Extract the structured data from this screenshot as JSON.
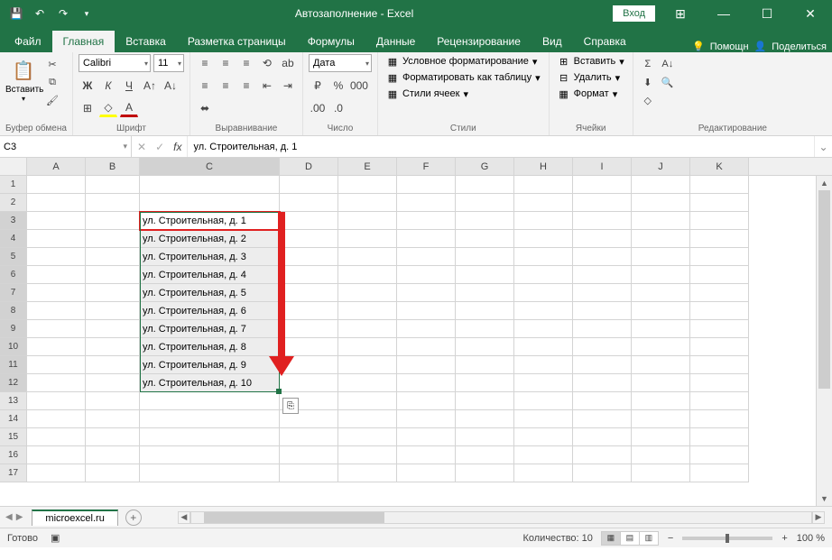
{
  "title": "Автозаполнение  -  Excel",
  "login": "Вход",
  "tabs": {
    "file": "Файл",
    "home": "Главная",
    "insert": "Вставка",
    "layout": "Разметка страницы",
    "formulas": "Формулы",
    "data": "Данные",
    "review": "Рецензирование",
    "view": "Вид",
    "help": "Справка",
    "tell": "Помощн",
    "share": "Поделиться"
  },
  "ribbon": {
    "clipboard": {
      "paste": "Вставить",
      "label": "Буфер обмена"
    },
    "font": {
      "name": "Calibri",
      "size": "11",
      "label": "Шрифт"
    },
    "alignment": {
      "label": "Выравнивание"
    },
    "number": {
      "format": "Дата",
      "label": "Число"
    },
    "styles": {
      "cond": "Условное форматирование",
      "table": "Форматировать как таблицу",
      "cell": "Стили ячеек",
      "label": "Стили"
    },
    "cells": {
      "insert": "Вставить",
      "delete": "Удалить",
      "format": "Формат",
      "label": "Ячейки"
    },
    "editing": {
      "label": "Редактирование"
    }
  },
  "namebox": "C3",
  "formula": "ул. Строительная, д. 1",
  "columns": [
    "A",
    "B",
    "C",
    "D",
    "E",
    "F",
    "G",
    "H",
    "I",
    "J",
    "K"
  ],
  "rows": [
    1,
    2,
    3,
    4,
    5,
    6,
    7,
    8,
    9,
    10,
    11,
    12,
    13,
    14,
    15,
    16,
    17
  ],
  "cells": {
    "C3": "ул. Строительная, д. 1",
    "C4": "ул. Строительная, д. 2",
    "C5": "ул. Строительная, д. 3",
    "C6": "ул. Строительная, д. 4",
    "C7": "ул. Строительная, д. 5",
    "C8": "ул. Строительная, д. 6",
    "C9": "ул. Строительная, д. 7",
    "C10": "ул. Строительная, д. 8",
    "C11": "ул. Строительная, д. 9",
    "C12": "ул. Строительная, д. 10"
  },
  "sheet": "microexcel.ru",
  "status": {
    "ready": "Готово",
    "count_label": "Количество:",
    "count": "10",
    "zoom": "100 %"
  }
}
